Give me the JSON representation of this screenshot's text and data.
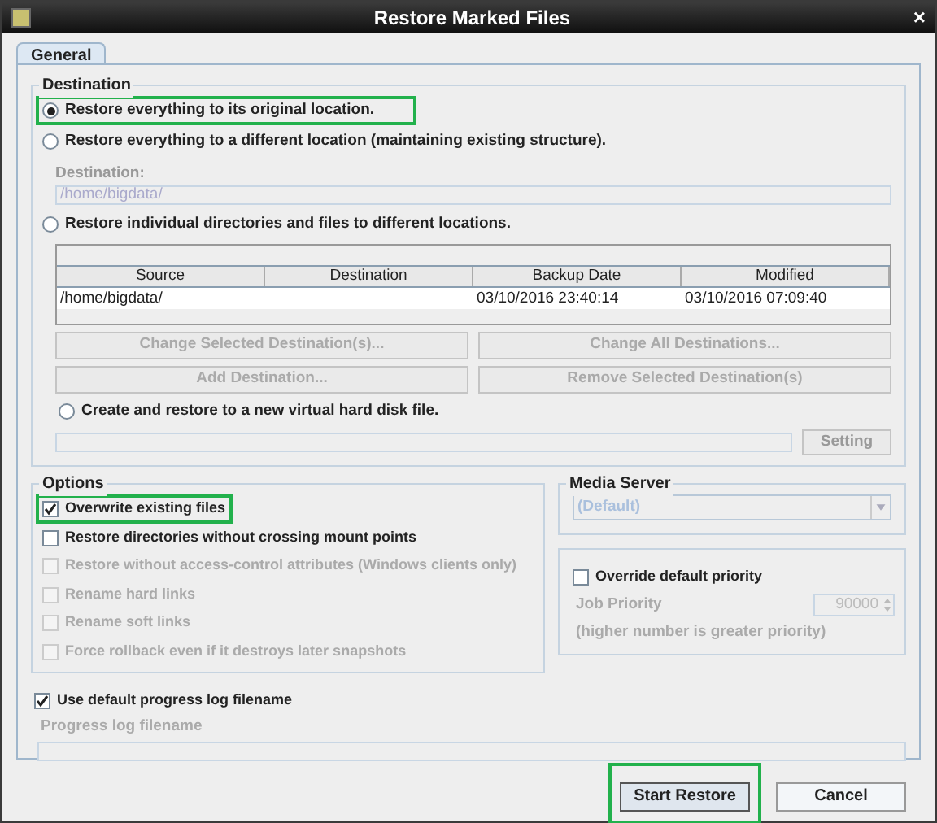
{
  "window": {
    "title": "Restore Marked Files",
    "close": "×"
  },
  "tabs": [
    {
      "label": "General",
      "selected": true
    }
  ],
  "destination": {
    "title": "Destination",
    "original": {
      "label": "Restore everything to its original location.",
      "selected": true,
      "highlighted": true
    },
    "different": {
      "label": "Restore everything to a different location (maintaining existing structure).",
      "selected": false,
      "field_label": "Destination:",
      "field_value": "/home/bigdata/",
      "disabled": true
    },
    "individual": {
      "label": "Restore individual directories and files to different locations.",
      "selected": false
    },
    "table": {
      "columns": [
        "Source",
        "Destination",
        "Backup Date",
        "Modified"
      ],
      "rows": [
        {
          "cells": [
            "/home/bigdata/",
            "",
            "03/10/2016 23:40:14",
            "03/10/2016 07:09:40"
          ]
        }
      ]
    },
    "buttons": [
      {
        "label": "Change Selected Destination(s)...",
        "disabled": true
      },
      {
        "label": "Change All Destinations...",
        "disabled": true
      },
      {
        "label": "Add Destination...",
        "disabled": true
      },
      {
        "label": "Remove Selected Destination(s)",
        "disabled": true
      }
    ],
    "vhd": {
      "label": "Create and restore to a new virtual hard disk file.",
      "selected": false,
      "button": "Setting"
    }
  },
  "options": {
    "title": "Options",
    "items": [
      {
        "label": "Overwrite existing files",
        "checked": true,
        "disabled": false,
        "highlighted": true
      },
      {
        "label": "Restore directories without crossing mount points",
        "checked": false,
        "disabled": false,
        "highlighted": false
      },
      {
        "label": "Restore without access-control attributes (Windows clients only)",
        "checked": false,
        "disabled": true,
        "highlighted": false
      },
      {
        "label": "Rename hard links",
        "checked": false,
        "disabled": true,
        "highlighted": false
      },
      {
        "label": "Rename soft links",
        "checked": false,
        "disabled": true,
        "highlighted": false
      },
      {
        "label": "Force rollback even if it destroys later snapshots",
        "checked": false,
        "disabled": true,
        "highlighted": false
      }
    ]
  },
  "media_server": {
    "title": "Media Server",
    "value": "(Default)",
    "disabled": true
  },
  "priority": {
    "label": "Override default priority",
    "checked": false,
    "field_label": "Job Priority",
    "value": "90000",
    "note": "(higher number is greater priority)"
  },
  "progress_log": {
    "label": "Use default progress log filename",
    "checked": true,
    "field_label": "Progress log filename"
  },
  "footer_buttons": [
    {
      "label": "Start Restore",
      "highlighted": true,
      "default": true
    },
    {
      "label": "Cancel",
      "highlighted": false,
      "default": false
    }
  ]
}
